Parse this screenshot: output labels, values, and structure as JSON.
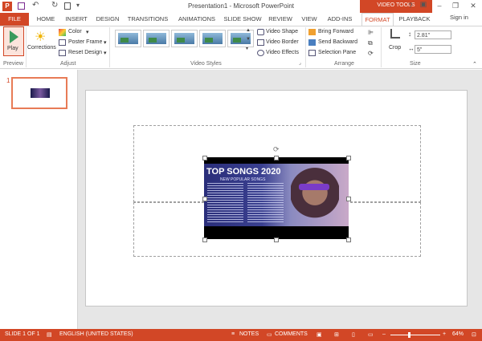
{
  "window": {
    "title": "Presentation1 - Microsoft PowerPoint",
    "context_group": "VIDEO TOOLS",
    "controls": [
      "?",
      "–",
      "❐",
      "✕"
    ]
  },
  "tabs": [
    "FILE",
    "HOME",
    "INSERT",
    "DESIGN",
    "TRANSITIONS",
    "ANIMATIONS",
    "SLIDE SHOW",
    "REVIEW",
    "VIEW",
    "ADD-INS",
    "FORMAT",
    "PLAYBACK"
  ],
  "signin": "Sign in",
  "ribbon": {
    "preview": {
      "play": "Play",
      "group": "Preview"
    },
    "adjust": {
      "corrections": "Corrections",
      "color": "Color",
      "poster_frame": "Poster Frame",
      "reset_design": "Reset Design",
      "group": "Adjust"
    },
    "video_styles": {
      "group": "Video Styles",
      "shape": "Video Shape",
      "border": "Video Border",
      "effects": "Video Effects"
    },
    "arrange": {
      "bring_forward": "Bring Forward",
      "send_backward": "Send Backward",
      "selection_pane": "Selection Pane",
      "group": "Arrange"
    },
    "size": {
      "crop": "Crop",
      "height": "2.81\"",
      "width": "5\"",
      "group": "Size"
    }
  },
  "slides_pane": {
    "number": "1"
  },
  "video": {
    "title": "TOP SONGS 2020",
    "subtitle": "NEW POPULAR SONGS"
  },
  "status": {
    "slide": "SLIDE 1 OF 1",
    "language": "ENGLISH (UNITED STATES)",
    "notes": "NOTES",
    "comments": "COMMENTS",
    "zoom": "64%"
  },
  "colors": {
    "accent": "#d24726"
  }
}
